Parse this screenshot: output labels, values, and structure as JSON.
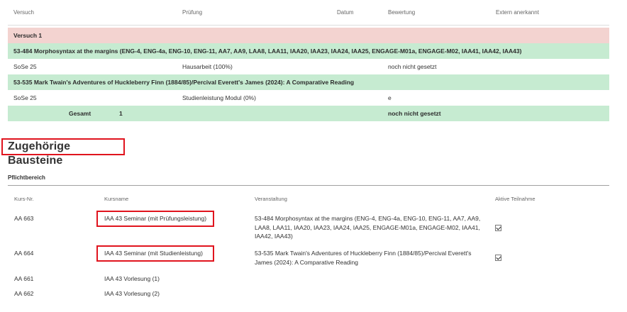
{
  "grades": {
    "headers": {
      "versuch": "Versuch",
      "pruefung": "Prüfung",
      "datum": "Datum",
      "bewertung": "Bewertung",
      "extern": "Extern anerkannt"
    },
    "attempt_label": "Versuch 1",
    "modules": [
      {
        "title": "53-484 Morphosyntax at the margins (ENG-4, ENG-4a, ENG-10, ENG-11, AA7, AA9, LAA8, LAA11, IAA20, IAA23, IAA24, IAA25, ENGAGE-M01a, ENGAGE-M02, IAA41, IAA42, IAA43)",
        "semester": "SoSe 25",
        "exam": "Hausarbeit (100%)",
        "grade": "noch nicht gesetzt"
      },
      {
        "title": "53-535 Mark Twain's Adventures of Huckleberry Finn (1884/85)/Percival Everett's James (2024): A Comparative Reading",
        "semester": "SoSe 25",
        "exam": "Studienleistung Modul (0%)",
        "grade": "e"
      }
    ],
    "total": {
      "label": "Gesamt",
      "attempt": "1",
      "grade": "noch nicht gesetzt"
    }
  },
  "bausteine": {
    "title": "Zugehörige Bausteine",
    "area_label": "Pflichtbereich",
    "headers": {
      "kursnr": "Kurs-Nr.",
      "kursname": "Kursname",
      "veranstaltung": "Veranstaltung",
      "aktiv": "Aktive Teilnahme"
    },
    "rows": [
      {
        "nr": "AA 663",
        "name": "IAA 43 Seminar (mit Prüfungsleistung)",
        "veranstaltung": "53-484 Morphosyntax at the margins (ENG-4, ENG-4a, ENG-10, ENG-11, AA7, AA9, LAA8, LAA11, IAA20, IAA23, IAA24, IAA25, ENGAGE-M01a, ENGAGE-M02, IAA41, IAA42, IAA43)",
        "aktiv": true
      },
      {
        "nr": "AA 664",
        "name": "IAA 43 Seminar (mit Studienleistung)",
        "veranstaltung": "53-535 Mark Twain's Adventures of Huckleberry Finn (1884/85)/Percival Everett's James (2024): A Comparative Reading",
        "aktiv": true
      },
      {
        "nr": "AA 661",
        "name": "IAA 43 Vorlesung (1)",
        "veranstaltung": "",
        "aktiv": false
      },
      {
        "nr": "AA 662",
        "name": "IAA 43 Vorlesung (2)",
        "veranstaltung": "",
        "aktiv": false
      }
    ]
  },
  "colors": {
    "attempt_row": "#f3d3d0",
    "module_row": "#c6ebd1",
    "highlight": "#e0141e"
  }
}
